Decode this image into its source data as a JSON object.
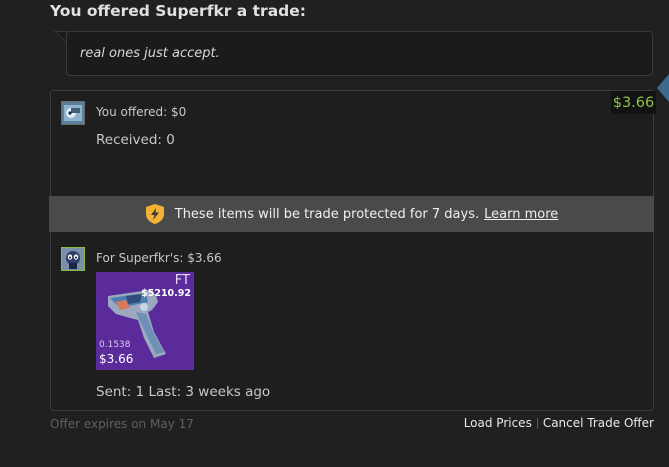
{
  "heading": "You offered Superfkr a trade:",
  "message": "real ones just accept.",
  "price_badge": "$3.66",
  "you_offered": "You offered: $0",
  "received": "Received: 0",
  "protection": {
    "text": "These items will be trade protected for 7 days.",
    "link": "Learn more",
    "icon": "shield-icon"
  },
  "for_them": "For Superfkr's: $3.66",
  "item": {
    "grade": "FT",
    "top_price": "$5210.92",
    "float": "0.1538",
    "price": "$3.66"
  },
  "sent": "Sent: 1 Last: 3 weeks ago",
  "footer": {
    "expires": "Offer expires on May 17",
    "load_prices": "Load Prices",
    "cancel": "Cancel Trade Offer"
  },
  "colors": {
    "price_green": "#8fc24a",
    "item_bg": "#5b2b9c",
    "protect_bar": "#4a4a4b"
  }
}
